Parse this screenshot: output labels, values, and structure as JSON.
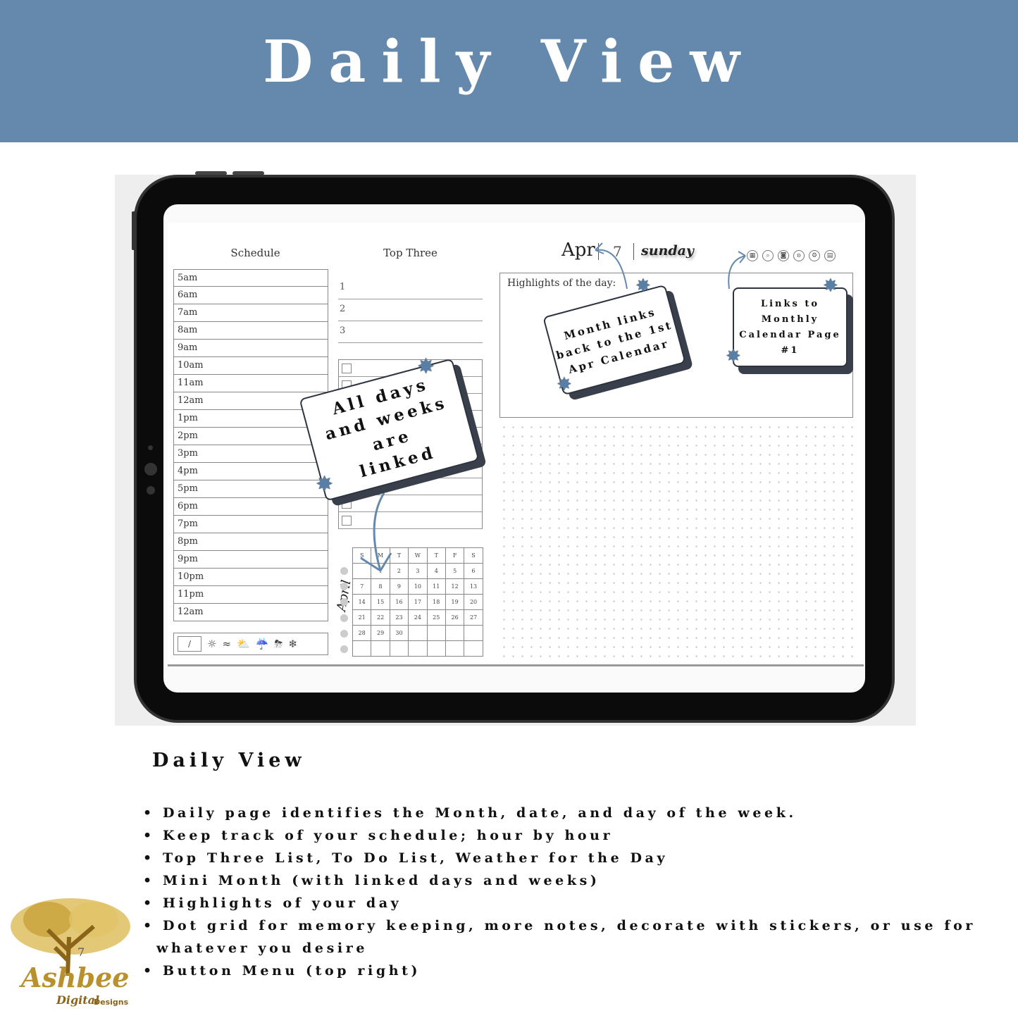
{
  "banner": {
    "title": "Daily View",
    "color": "#6589ad"
  },
  "planner": {
    "schedule_header": "Schedule",
    "top_three_header": "Top Three",
    "hours": [
      "5am",
      "6am",
      "7am",
      "8am",
      "9am",
      "10am",
      "11am",
      "12am",
      "1pm",
      "2pm",
      "3pm",
      "4pm",
      "5pm",
      "6pm",
      "7pm",
      "8pm",
      "9pm",
      "10pm",
      "11pm",
      "12am"
    ],
    "top_three": [
      "1",
      "2",
      "3"
    ],
    "weather": {
      "date_placeholder": "/",
      "icons": [
        "sun-icon",
        "wind-icon",
        "partly-cloudy-icon",
        "rain-icon",
        "storm-icon",
        "snowflake-icon"
      ]
    },
    "month": "Apr",
    "day": "7",
    "weekday": "sunday",
    "menu_icons": [
      "calendar-icon",
      "search-icon",
      "camera-icon",
      "fingerprint-icon",
      "settings-icon",
      "notes-icon"
    ],
    "highlights_label": "Highlights of the day:",
    "mini_calendar": {
      "month_label": "April",
      "weekdays": [
        "S",
        "M",
        "T",
        "W",
        "T",
        "F",
        "S"
      ],
      "weeks": [
        [
          "",
          "1",
          "2",
          "3",
          "4",
          "5",
          "6"
        ],
        [
          "7",
          "8",
          "9",
          "10",
          "11",
          "12",
          "13"
        ],
        [
          "14",
          "15",
          "16",
          "17",
          "18",
          "19",
          "20"
        ],
        [
          "21",
          "22",
          "23",
          "24",
          "25",
          "26",
          "27"
        ],
        [
          "28",
          "29",
          "30",
          "",
          "",
          "",
          ""
        ],
        [
          "",
          "",
          "",
          "",
          "",
          "",
          ""
        ]
      ]
    }
  },
  "callouts": {
    "linked": [
      "All days",
      "and weeks",
      "are",
      "linked"
    ],
    "month_links": [
      "Month links",
      "back to the 1st",
      "Apr Calendar"
    ],
    "monthly_page": [
      "Links to",
      "Monthly",
      "Calendar Page",
      "#1"
    ],
    "accent": "#5a7fa6"
  },
  "description": {
    "title": "Daily View",
    "bullets": [
      "Daily page identifies the Month, date, and day of the week.",
      "Keep track of your schedule; hour by hour",
      "Top Three List, To Do List, Weather for the Day",
      "Mini Month (with linked days and weeks)",
      "Highlights of your day",
      "Dot grid for memory keeping, more notes, decorate with stickers, or use for whatever you desire",
      "Button Menu (top right)"
    ]
  },
  "logo": {
    "text": "Ashbee",
    "sub": "Digital",
    "sub2": "Designs",
    "number": "7",
    "color": "#b8902c"
  }
}
